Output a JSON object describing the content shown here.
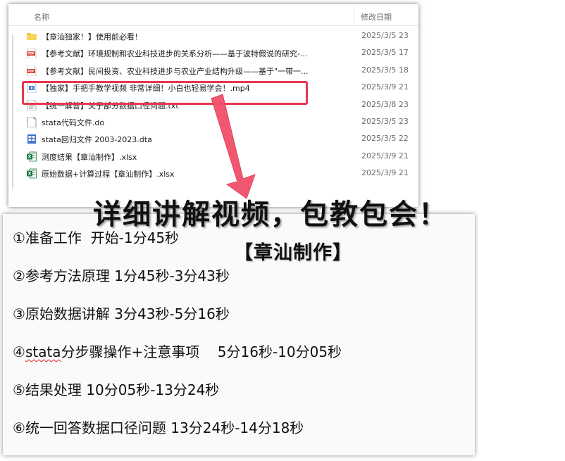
{
  "explorer": {
    "columns": {
      "name": "名称",
      "modified": "修改日期"
    },
    "files": [
      {
        "name": "【章汕独家！】使用前必看！",
        "date": "2025/3/5 23",
        "icon": "folder-icon",
        "color": "#f4c430"
      },
      {
        "name": "【参考文献】环境规制和农业科技进步的关系分析——基于波特假说的研究-...",
        "date": "2025/3/5 17",
        "icon": "pdf-icon",
        "color": "#d93a2b",
        "badge": "PDF"
      },
      {
        "name": "【参考文献】民间投资、农业科技进步与农业产业结构升级——基于\"一带一...",
        "date": "2025/3/5 18",
        "icon": "pdf-icon",
        "color": "#d93a2b",
        "badge": "PDF"
      },
      {
        "name": "【独家】手把手教学视频 非常详细！小白也轻易学会！.mp4",
        "date": "2025/3/9 21",
        "icon": "video-file-icon",
        "color": "#4a7fd4"
      },
      {
        "name": "【统一解答】关于部分数据口径问题.txt",
        "date": "2025/3/8 23",
        "icon": "text-file-icon",
        "color": "#8a8a8a"
      },
      {
        "name": "stata代码文件.do",
        "date": "2025/3/5 23",
        "icon": "blank-file-icon",
        "color": "#8a8a8a"
      },
      {
        "name": "stata回归文件 2003-2023.dta",
        "date": "2025/3/5 22",
        "icon": "data-file-icon",
        "color": "#3b6fc9"
      },
      {
        "name": "测度结果【章汕制作】.xlsx",
        "date": "2025/3/9 21",
        "icon": "excel-icon",
        "color": "#1e7a45",
        "badge": "X"
      },
      {
        "name": "原始数据+计算过程【章汕制作】.xlsx",
        "date": "2025/3/9 21",
        "icon": "excel-icon",
        "color": "#1e7a45",
        "badge": "X"
      }
    ]
  },
  "overlay": {
    "headline": "详细讲解视频，包教包会！",
    "subheadline": "【章汕制作】",
    "accent_color": "#e8384f"
  },
  "chapters": [
    {
      "num": "①",
      "title": "准备工作",
      "time": "开始-1分45秒"
    },
    {
      "num": "②",
      "title": "参考方法原理",
      "time": "1分45秒-3分43秒"
    },
    {
      "num": "③",
      "title": "原始数据讲解",
      "time": "3分43秒-5分16秒"
    },
    {
      "num": "④",
      "title_squiggle": "stata",
      "title": "分步骤操作+注意事项",
      "time": "5分16秒-10分05秒"
    },
    {
      "num": "⑤",
      "title": "结果处理",
      "time": "10分05秒-13分24秒"
    },
    {
      "num": "⑥",
      "title": "统一回答数据口径问题",
      "time": "13分24秒-14分18秒"
    }
  ]
}
